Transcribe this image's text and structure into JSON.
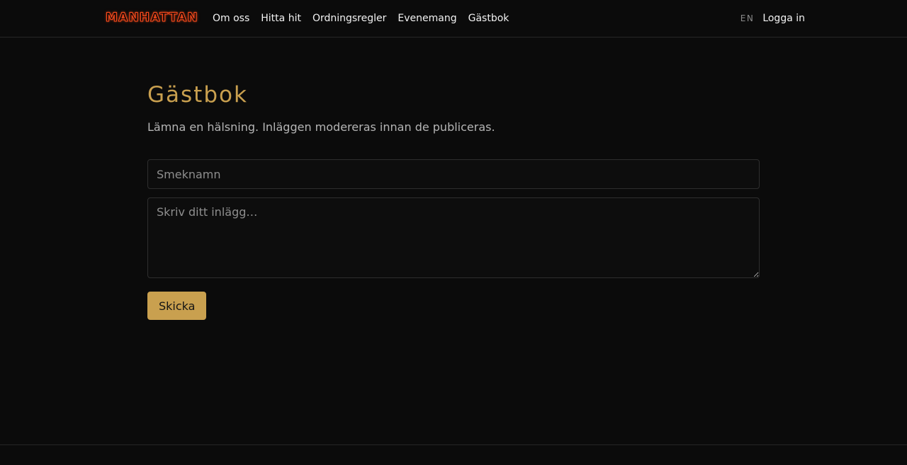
{
  "nav": {
    "brand": "MANHATTAN",
    "links": [
      "Om oss",
      "Hitta hit",
      "Ordningsregler",
      "Evenemang",
      "Gästbok"
    ],
    "lang": "EN",
    "login": "Logga in"
  },
  "guestbook": {
    "title": "Gästbok",
    "subtitle": "Lämna en hälsning. Inläggen modereras innan de publiceras.",
    "nickname_placeholder": "Smeknamn",
    "nickname_value": "",
    "post_placeholder": "Skriv ditt inlägg…",
    "post_value": "",
    "submit_label": "Skicka"
  },
  "colors": {
    "background": "#0b0b0b",
    "accent": "#c9a04f",
    "brand": "#ff4a1c"
  }
}
